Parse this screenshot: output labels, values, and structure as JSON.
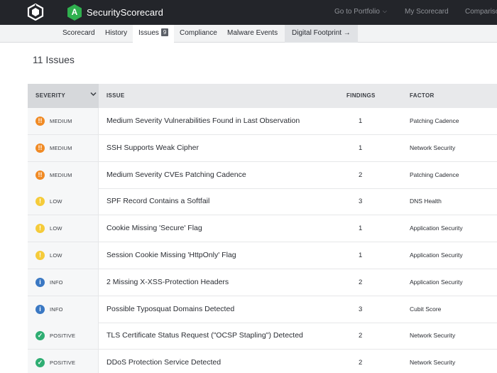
{
  "app": {
    "brand": "SecurityScorecard",
    "grade": "A",
    "grade_color": "#2fb04e"
  },
  "topnav": {
    "portfolio": "Go to Portfolio",
    "my_scorecard": "My Scorecard",
    "compare": "Comparison"
  },
  "subnav": {
    "scorecard": "Scorecard",
    "history": "History",
    "issues": "Issues",
    "issues_count": "9",
    "compliance": "Compliance",
    "malware": "Malware Events",
    "digital": "Digital Footprint →"
  },
  "page": {
    "title": "11 Issues"
  },
  "table": {
    "headers": {
      "severity": "SEVERITY",
      "issue": "ISSUE",
      "findings": "FINDINGS",
      "factor": "FACTOR"
    },
    "rows": [
      {
        "severity": "MEDIUM",
        "icon": "!!",
        "color": "#f08a24",
        "issue": "Medium Severity Vulnerabilities Found in Last Observation",
        "findings": "1",
        "factor": "Patching Cadence"
      },
      {
        "severity": "MEDIUM",
        "icon": "!!",
        "color": "#f08a24",
        "issue": "SSH Supports Weak Cipher",
        "findings": "1",
        "factor": "Network Security"
      },
      {
        "severity": "MEDIUM",
        "icon": "!!",
        "color": "#f08a24",
        "issue": "Medium Severity CVEs Patching Cadence",
        "findings": "2",
        "factor": "Patching Cadence"
      },
      {
        "severity": "LOW",
        "icon": "!",
        "color": "#f5cb3a",
        "issue": "SPF Record Contains a Softfail",
        "findings": "3",
        "factor": "DNS Health"
      },
      {
        "severity": "LOW",
        "icon": "!",
        "color": "#f5cb3a",
        "issue": "Cookie Missing 'Secure' Flag",
        "findings": "1",
        "factor": "Application Security"
      },
      {
        "severity": "LOW",
        "icon": "!",
        "color": "#f5cb3a",
        "issue": "Session Cookie Missing 'HttpOnly' Flag",
        "findings": "1",
        "factor": "Application Security"
      },
      {
        "severity": "INFO",
        "icon": "i",
        "color": "#3a78c3",
        "issue": "2 Missing X-XSS-Protection Headers",
        "findings": "2",
        "factor": "Application Security"
      },
      {
        "severity": "INFO",
        "icon": "i",
        "color": "#3a78c3",
        "issue": "Possible Typosquat Domains Detected",
        "findings": "3",
        "factor": "Cubit Score"
      },
      {
        "severity": "POSITIVE",
        "icon": "✓",
        "color": "#2fae73",
        "issue": "TLS Certificate Status Request (\"OCSP Stapling\") Detected",
        "findings": "2",
        "factor": "Network Security"
      },
      {
        "severity": "POSITIVE",
        "icon": "✓",
        "color": "#2fae73",
        "issue": "DDoS Protection Service Detected",
        "findings": "2",
        "factor": "Network Security"
      }
    ]
  }
}
